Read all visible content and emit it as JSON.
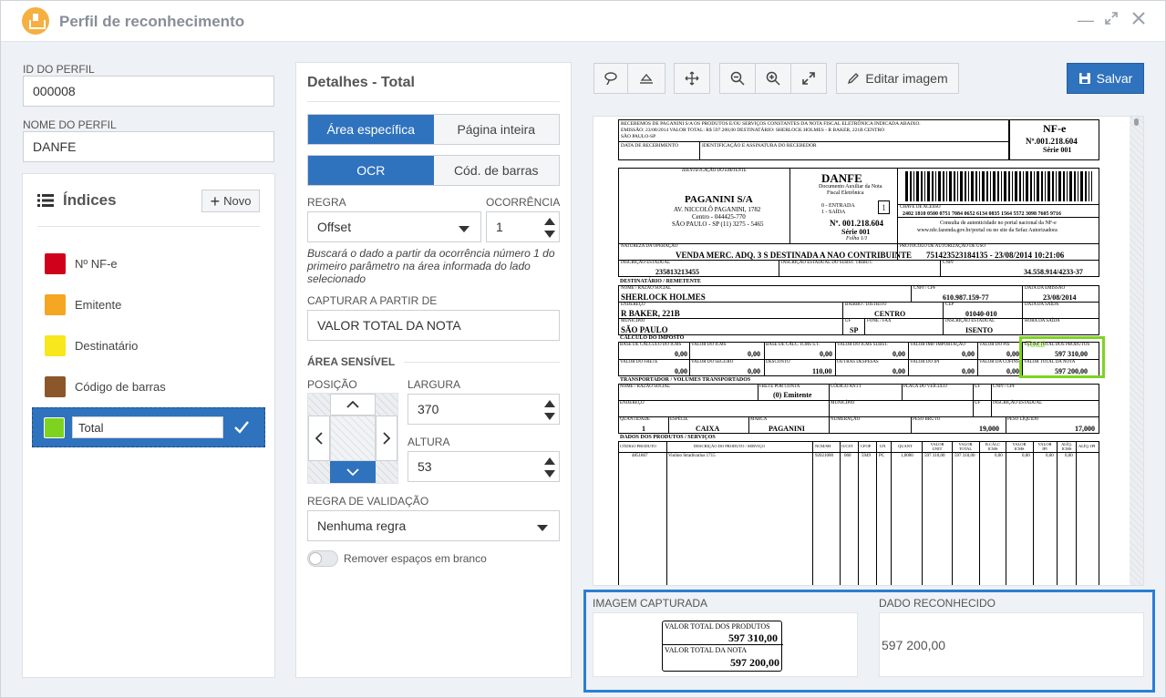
{
  "window": {
    "title": "Perfil de reconhecimento"
  },
  "profile": {
    "id_label": "ID DO PERFIL",
    "id_value": "000008",
    "name_label": "NOME DO PERFIL",
    "name_value": "DANFE"
  },
  "indices": {
    "title": "Índices",
    "new_label": "Novo",
    "items": [
      {
        "label": "Nº NF-e",
        "color": "#d0021b"
      },
      {
        "label": "Emitente",
        "color": "#f5a623"
      },
      {
        "label": "Destinatário",
        "color": "#f8e71c"
      },
      {
        "label": "Código de barras",
        "color": "#8b572a"
      },
      {
        "label": "Total",
        "color": "#7ed321"
      }
    ]
  },
  "details": {
    "title": "Detalhes - Total",
    "area_tabs": [
      "Área específica",
      "Página inteira"
    ],
    "mode_tabs": [
      "OCR",
      "Cód. de barras"
    ],
    "rule_label": "REGRA",
    "rule_value": "Offset",
    "occurrence_label": "OCORRÊNCIA",
    "occurrence_value": "1",
    "help_text": "Buscará o dado a partir da ocorrência número 1 do primeiro parâmetro na área informada do lado selecionado",
    "capture_from_label": "CAPTURAR A PARTIR DE",
    "capture_from_value": "VALOR TOTAL DA NOTA",
    "sensitive_area_label": "ÁREA SENSÍVEL",
    "position_label": "POSIÇÃO",
    "width_label": "LARGURA",
    "width_value": "370",
    "height_label": "ALTURA",
    "height_value": "53",
    "validation_label": "REGRA DE VALIDAÇÃO",
    "validation_value": "Nenhuma regra",
    "remove_spaces_label": "Remover espaços em branco"
  },
  "toolbar": {
    "edit_image_label": "Editar imagem",
    "save_label": "Salvar"
  },
  "document": {
    "receipt": "RECEBEMOS DE PAGANINI S/A OS PRODUTOS E/OU SERVIÇOS CONSTANTES DA NOTA FISCAL ELETRÔNICA INDICADA ABAIXO.",
    "receipt2": "EMISSÃO: 23/08/2014 VALOR TOTAL: R$ 597.200,00 DESTINATÁRIO: SHERLOCK HOLMES - R BAKER, 221B CENTRO",
    "receipt3": "SÃO PAULO-SP",
    "data_recebimento": "DATA DE RECEBIMENTO",
    "identificacao": "IDENTIFICAÇÃO E ASSINATURA DO RECEBEDOR",
    "nfe": "NF-e",
    "nfe_num": "Nº.001.218.604",
    "serie": "Série 001",
    "id_emitente": "IDENTIFICAÇÃO DO EMITENTE",
    "company": "PAGANINI S/A",
    "addr1": "AV. NICCOLÔ PAGANINI, 1782",
    "addr2": "Centro - 044425-770",
    "addr3": "SÃO PAULO - SP (11) 3275 - 5465",
    "danfe": "DANFE",
    "danfe_sub1": "Documento Auxiliar da Nota",
    "danfe_sub2": "Fiscal Eletrônica",
    "entrada": "0 - ENTRADA",
    "saida": "1 - SAÍDA",
    "tipo": "1",
    "danfe_num": "Nº. 001.218.604",
    "danfe_serie": "Série 001",
    "folha": "Folha 1/1",
    "chave_label": "CHAVE DE ACESSO",
    "chave": "2402 1810 0500 0751 7084 0652 6134 0835 1564 5572 3098 7605 9716",
    "consulta1": "Consulta de autenticidade no portal nacional da NF-e",
    "consulta2": "www.nfe.fazenda.gov.br/portal ou no site da Sefaz Autorizadora",
    "natureza_label": "NATUREZA DA OPERAÇÃO",
    "natureza": "VENDA MERC. ADQ. 3 S DESTINADA A NAO CONTRIBUINTE",
    "protocolo_label": "PROTOCOLO DE AUTORIZAÇÃO DE USO",
    "protocolo": "751423523184135 - 23/08/2014 10:21:06",
    "ie_label": "INSCRIÇÃO ESTADUAL",
    "ie": "235813213455",
    "iest_label": "INSCRIÇÃO ESTADUAL DO SUBST. TRIBUT.",
    "cnpj_label": "CNPJ",
    "cnpj": "34.558.914/4233-37",
    "dest_label": "DESTINATÁRIO / REMETENTE",
    "nome_label": "NOME / RAZÃO SOCIAL",
    "nome": "SHERLOCK HOLMES",
    "cpf_label": "CNPJ / CPF",
    "cpf": "610.987.159-77",
    "emissao_label": "DATA DA EMISSÃO",
    "emissao": "23/08/2014",
    "end_label": "ENDEREÇO",
    "end": "R BAKER, 221B",
    "bairro_label": "BAIRRO / DISTRITO",
    "bairro": "CENTRO",
    "cep_label": "CEP",
    "cep": "01040-010",
    "saida_label": "DATA DA SAÍDA",
    "mun_label": "MUNICÍPIO",
    "mun": "SÃO PAULO",
    "uf_label": "UF",
    "uf": "SP",
    "fone_label": "FONE / FAX",
    "ie2_label": "INSCRIÇÃO ESTADUAL",
    "ie2": "ISENTO",
    "hora_label": "HORA DA SAÍDA",
    "calc_label": "CÁLCULO DO IMPOSTO",
    "c1": "BASE DE CÁLCULO DO ICMS",
    "c2": "VALOR DO ICMS",
    "c3": "BASE DE CÁLC. ICMS S.T.",
    "c4": "VALOR DO ICMS SUBST.",
    "c5": "VALOR IMP. IMPORTAÇÃO",
    "c6": "VALOR DO PIS",
    "c7": "VALOR TOTAL DOS PRODUTOS",
    "d1": "VALOR DO FRETE",
    "d2": "VALOR DO SEGURO",
    "d3": "DESCONTO",
    "d4": "OUTRAS DESPESAS",
    "d5": "VALOR DO IPI",
    "d6": "VALOR DA COFINS",
    "d7": "VALOR TOTAL DA NOTA",
    "zero": "0,00",
    "desconto": "110,00",
    "total_prod": "597 310,00",
    "total_nota": "597 200,00",
    "total_tag": "Total",
    "transp_label": "TRANSPORTADOR / VOLUMES TRANSPORTADOS",
    "frete_label": "FRETE POR CONTA",
    "frete": "(0) Emitente",
    "antt": "CÓDIGO ANTT",
    "placa": "PLACA DO VEÍCULO",
    "qtd_label": "QUANTIDADE",
    "qtd": "1",
    "esp_label": "ESPÉCIE",
    "esp": "CAIXA",
    "marca_label": "MARCA",
    "marca": "PAGANINI",
    "numeracao": "NUMERAÇÃO",
    "pb_label": "PESO BRUTO",
    "pb": "19,000",
    "pl_label": "PESO LÍQUIDO",
    "pl": "17,000",
    "prod_label": "DADOS DOS PRODUTOS / SERVIÇOS",
    "h_cod": "CÓDIGO PRODUTO",
    "h_desc": "DESCRIÇÃO DO PRODUTO / SERVIÇO",
    "h_ncm": "NCM/SH",
    "h_cst": "O/CST",
    "h_cfop": "CFOP",
    "h_un": "UN",
    "h_qtd": "QUANT",
    "h_vu": "VALOR UNIT",
    "h_vt": "VALOR TOTAL",
    "h_bc": "B.CÁLC ICMS",
    "h_vi": "VALOR ICMS",
    "h_ipi": "VALOR IPI",
    "h_aliq": "ALÍQ. ICMS",
    "h_aliqipi": "ALÍQ. IPI",
    "p_cod": "4851867",
    "p_desc": "Violino Stradivarius 1715",
    "p_ncm": "92021000",
    "p_cst": "060",
    "p_cfop": "5949",
    "p_un": "PC",
    "p_qtd": "1,0000",
    "p_vu": "597 310,00",
    "p_vt": "597 310,00",
    "p_bc": "0,00",
    "p_vi": "0,00",
    "p_ipi": "0,00",
    "p_aliq": "0,00"
  },
  "capture": {
    "image_label": "IMAGEM CAPTURADA",
    "data_label": "DADO RECONHECIDO",
    "snippet_line1": "VALOR TOTAL DOS PRODUTOS",
    "snippet_val1": "597 310,00",
    "snippet_line2": "VALOR TOTAL DA NOTA",
    "snippet_val2": "597 200,00",
    "recognized_value": "597 200,00"
  }
}
